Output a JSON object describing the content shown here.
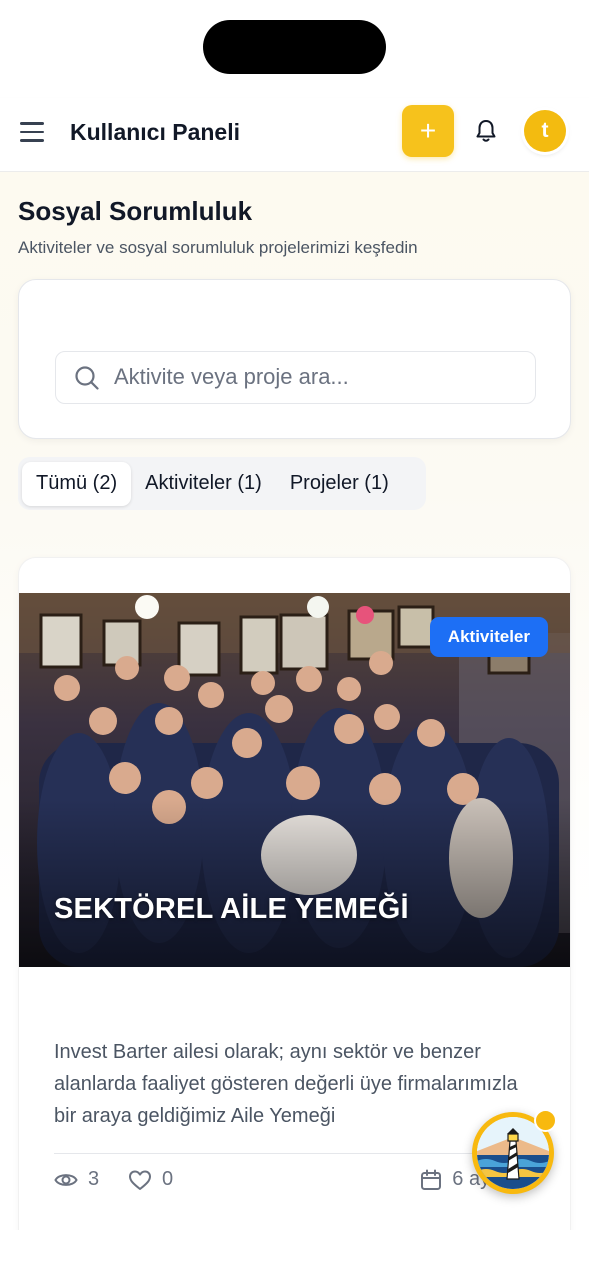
{
  "header": {
    "title": "Kullanıcı Paneli",
    "add_label": "+",
    "avatar_initial": "t",
    "accent_color": "#f6c21c"
  },
  "page": {
    "title": "Sosyal Sorumluluk",
    "subtitle": "Aktiviteler ve sosyal sorumluluk projelerimizi keşfedin"
  },
  "search": {
    "placeholder": "Aktivite veya proje ara...",
    "value": ""
  },
  "tabs": [
    {
      "label": "Tümü (2)",
      "active": true
    },
    {
      "label": "Aktiviteler (1)",
      "active": false
    },
    {
      "label": "Projeler (1)",
      "active": false
    }
  ],
  "cards": [
    {
      "badge": "Aktiviteler",
      "badge_color": "#1d6ff5",
      "title": "SEKTÖREL AİLE YEMEĞİ",
      "description": "Invest Barter ailesi olarak; aynı sektör ve benzer alanlarda faaliyet gösteren değerli üye firmalarımızla bir araya geldiğimiz Aile Yemeği",
      "views": "3",
      "likes": "0",
      "date": "6 ay önce"
    }
  ],
  "icons": {
    "menu": "hamburger-icon",
    "bell": "bell-icon",
    "search": "search-icon",
    "views": "eye-icon",
    "likes": "heart-icon",
    "date": "calendar-icon",
    "assistant": "lighthouse-icon"
  }
}
